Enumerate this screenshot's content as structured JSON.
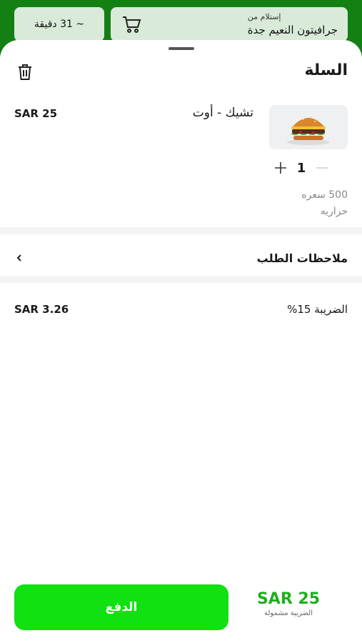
{
  "header": {
    "pickup_label": "إستلام من",
    "pickup_store": "جرافيتون النعيم جدة",
    "eta": "~ 31 دقيقة"
  },
  "cart": {
    "title": "السلة",
    "item": {
      "name": "تشيك - أوت",
      "price": "SAR 25",
      "quantity": "1",
      "calories": "500 سعره",
      "calories_unit": "حراريه"
    }
  },
  "notes": {
    "label": "ملاحظات الطلب"
  },
  "tax": {
    "label": "الضريبة 15%",
    "value": "SAR 3.26"
  },
  "footer": {
    "pay_label": "الدفع",
    "total": "SAR 25",
    "total_note": "الضريبة مشمولة"
  },
  "colors": {
    "brand_green": "#138013",
    "pay_button": "#11e011",
    "total_green": "#1cb01c"
  },
  "icons": [
    "cart-icon",
    "trash-icon",
    "plus-icon",
    "minus-icon",
    "chevron-left-icon"
  ]
}
